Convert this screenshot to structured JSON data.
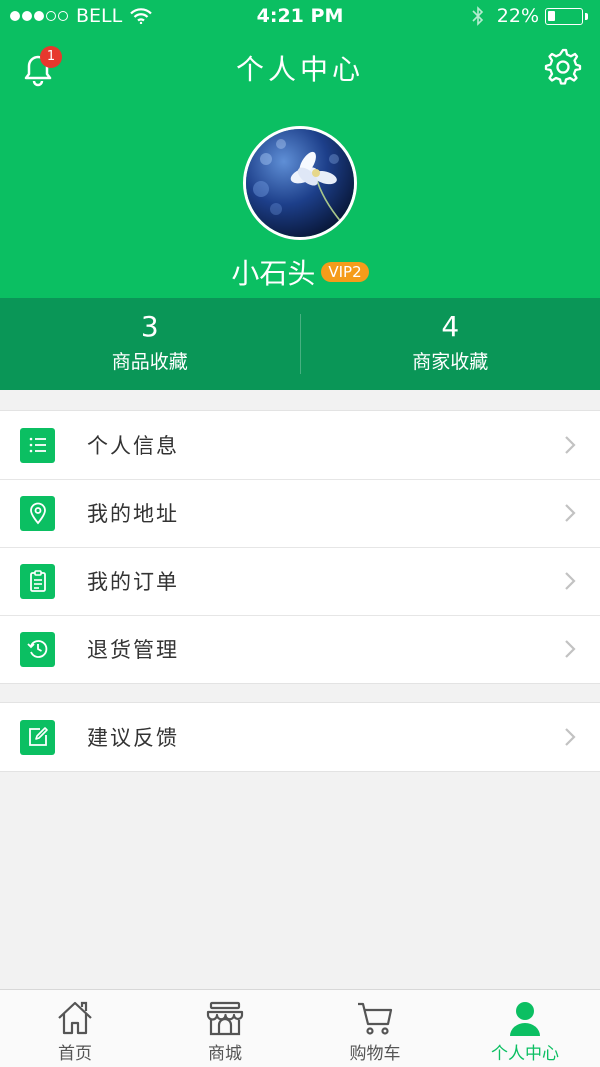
{
  "status_bar": {
    "carrier": "BELL",
    "time": "4:21 PM",
    "battery": "22%",
    "battery_level": 0.22
  },
  "header": {
    "title": "个人中心",
    "notification_count": "1",
    "accent_color": "#0bbf62"
  },
  "profile": {
    "username": "小石头",
    "vip_badge": "VIP2"
  },
  "stats": [
    {
      "value": "3",
      "label": "商品收藏"
    },
    {
      "value": "4",
      "label": "商家收藏"
    }
  ],
  "menu_group_1": [
    {
      "label": "个人信息",
      "icon": "list-icon"
    },
    {
      "label": "我的地址",
      "icon": "location-pin-icon"
    },
    {
      "label": "我的订单",
      "icon": "clipboard-icon"
    },
    {
      "label": "退货管理",
      "icon": "history-icon"
    }
  ],
  "menu_group_2": [
    {
      "label": "建议反馈",
      "icon": "edit-icon"
    }
  ],
  "tabbar": [
    {
      "label": "首页",
      "icon": "home-icon"
    },
    {
      "label": "商城",
      "icon": "store-icon"
    },
    {
      "label": "购物车",
      "icon": "cart-icon"
    },
    {
      "label": "个人中心",
      "icon": "person-icon",
      "active": true
    }
  ]
}
